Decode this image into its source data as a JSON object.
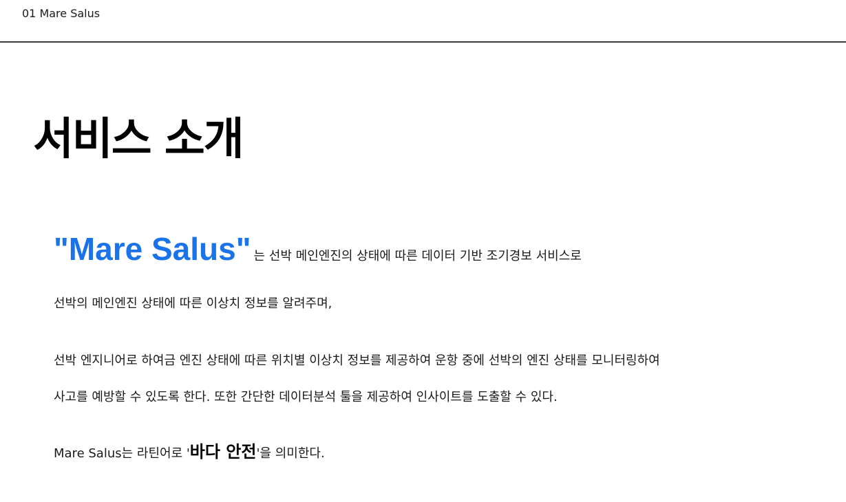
{
  "header": {
    "title": "01 Mare Salus"
  },
  "main": {
    "title": "서비스 소개",
    "intro": {
      "brand_quoted": "\"Mare Salus\"",
      "rest": "는 선박 메인엔진의 상태에 따른 데이터 기반 조기경보 서비스로"
    },
    "paragraph1": "선박의 메인엔진 상태에 따른 이상치 정보를 알려주며,",
    "paragraph2_line1": "선박 엔지니어로 하여금 엔진 상태에 따른 위치별 이상치 정보를 제공하여 운항 중에 선박의 엔진 상태를 모니터링하여",
    "paragraph2_line2": "사고를 예방할 수 있도록 한다. 또한 간단한 데이터분석 툴을 제공하여 인사이트를 도출할 수 있다.",
    "meaning": {
      "prefix": "Mare Salus는 라틴어로 '",
      "strong": "바다 안전",
      "suffix": "'을 의미한다."
    }
  },
  "colors": {
    "accent": "#1a73e8",
    "divider": "#3a3a3a"
  }
}
